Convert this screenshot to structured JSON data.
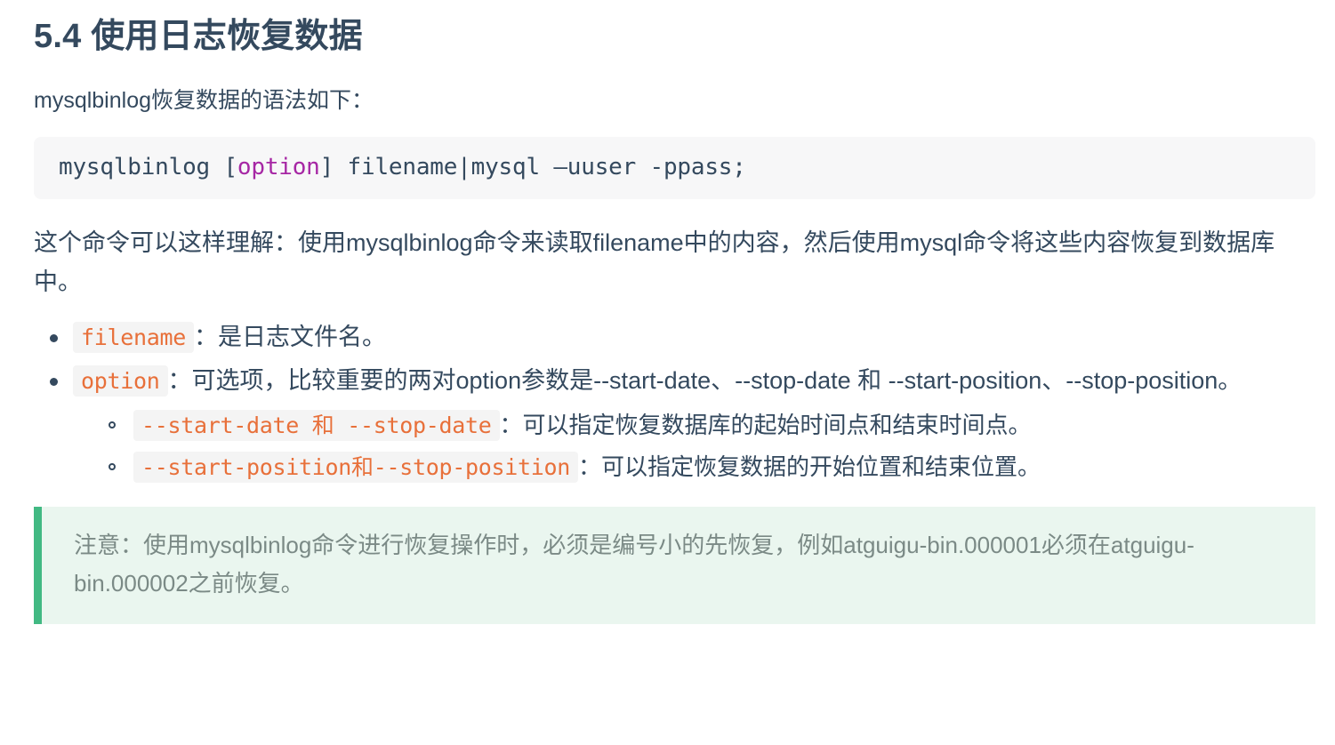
{
  "document": {
    "heading": {
      "number": "5.4",
      "title": "使用日志恢复数据",
      "full": "5.4 使用日志恢复数据"
    },
    "intro_paragraph": "mysqlbinlog恢复数据的语法如下：",
    "code_block": {
      "language": "shell",
      "segments": {
        "before": "mysqlbinlog [",
        "keyword": "option",
        "after": "] filename|mysql –uuser -ppass;"
      },
      "full_text": "mysqlbinlog [option] filename|mysql –uuser -ppass;",
      "keyword_color": "#a626a4",
      "text_color": "#34495e",
      "background": "#f7f7f8"
    },
    "explanation_paragraph": "这个命令可以这样理解：使用mysqlbinlog命令来读取filename中的内容，然后使用mysql命令将这些内容恢复到数据库中。",
    "bullets": [
      {
        "code": "filename",
        "text": "：是日志文件名。"
      },
      {
        "code": "option",
        "text": "：可选项，比较重要的两对option参数是--start-date、--stop-date 和 --start-position、--stop-position。",
        "sub_bullets": [
          {
            "code_before": "--start-date ",
            "code_han": "和",
            "code_after": " --stop-date",
            "code_full": "--start-date 和 --stop-date",
            "text": "：可以指定恢复数据库的起始时间点和结束时间点。"
          },
          {
            "code_before": "--start-position",
            "code_han": "和",
            "code_after": "--stop-position",
            "code_full": "--start-position和--stop-position",
            "text": "：可以指定恢复数据的开始位置和结束位置。"
          }
        ]
      }
    ],
    "note": {
      "text": "注意：使用mysqlbinlog命令进行恢复操作时，必须是编号小的先恢复，例如atguigu-bin.000001必须在atguigu-bin.000002之前恢复。",
      "accent_color": "#42b983",
      "background": "#eaf6ef",
      "text_color": "#7b8a86"
    },
    "colors": {
      "heading": "#34495e",
      "body_text": "#34495e",
      "inline_code": "#e8703a",
      "inline_code_bg": "#f4f4f4"
    }
  }
}
